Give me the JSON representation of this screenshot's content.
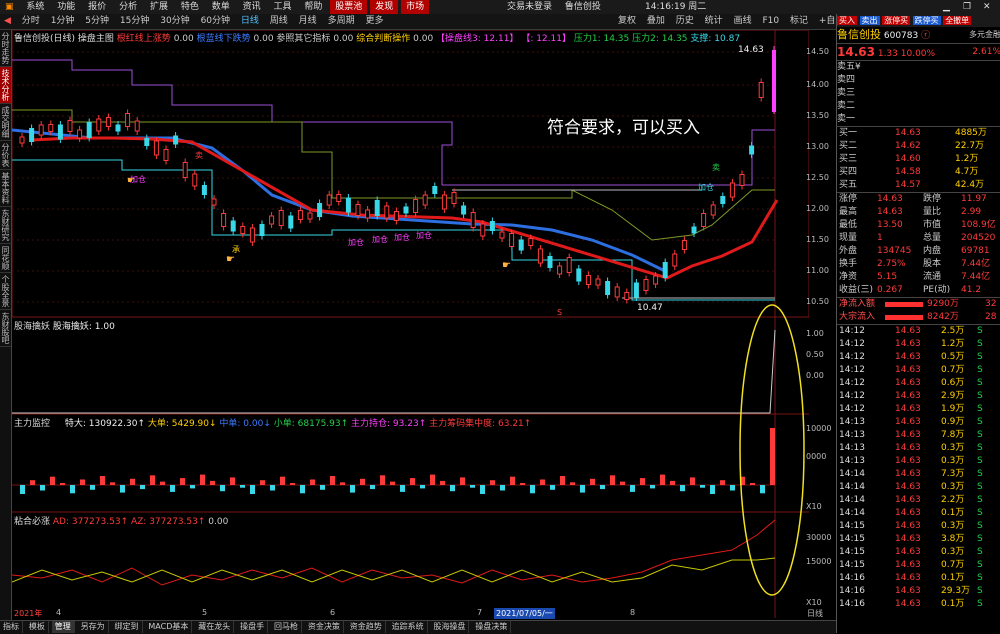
{
  "menubar": {
    "items": [
      "系统",
      "功能",
      "报价",
      "分析",
      "扩展",
      "特色",
      "数单",
      "资讯",
      "工具",
      "帮助"
    ],
    "hl_items": [
      "股票池",
      "发现",
      "市场"
    ],
    "center": [
      "交易未登录",
      "鲁信创投"
    ],
    "time": "14:16:19 周二"
  },
  "toolbar": {
    "periods": [
      "分时",
      "1分钟",
      "5分钟",
      "15分钟",
      "30分钟",
      "60分钟",
      "日线",
      "周线",
      "月线",
      "多周期",
      "更多"
    ],
    "active_period": "日线",
    "right_buttons": [
      "复权",
      "叠加",
      "历史",
      "统计",
      "画线",
      "F10",
      "标记",
      "+自选",
      "返回"
    ]
  },
  "left_tabs": [
    "分时走势",
    "技术分析",
    "成交明细",
    "分价表",
    "基本资料",
    "东财研究",
    "同花顺",
    "个股全景",
    "东财股吧"
  ],
  "left_tab_active": "技术分析",
  "main_header": {
    "name": "鲁信创投(日线)",
    "panel": "操盘主图",
    "items": [
      {
        "text": "根红线上涨势",
        "color": "#ff3a3a"
      },
      {
        "text": "0.00",
        "color": "#cccccc"
      },
      {
        "text": "根蓝线下跌势",
        "color": "#3a7cff"
      },
      {
        "text": "0.00",
        "color": "#cccccc"
      },
      {
        "text": "参照其它指标",
        "color": "#cccccc"
      },
      {
        "text": "0.00",
        "color": "#cccccc"
      },
      {
        "text": "综合判断操作",
        "color": "#ffd000"
      },
      {
        "text": "0.00",
        "color": "#cccccc"
      },
      {
        "text": "【操盘线3: 12.11】",
        "color": "#ff40ff"
      },
      {
        "text": "【: 12.11】",
        "color": "#ff40ff"
      },
      {
        "text": "压力1: 14.35",
        "color": "#22d04a"
      },
      {
        "text": "压力2: 14.35",
        "color": "#22d04a"
      },
      {
        "text": "支撑: 10.87",
        "color": "#38d8e8"
      }
    ]
  },
  "price_axis": [
    "14.50",
    "14.00",
    "13.50",
    "13.00",
    "12.50",
    "12.00",
    "11.50",
    "11.00",
    "10.50"
  ],
  "annotations": {
    "headline": "符合要求，可以买入",
    "high_mark": "14.63",
    "low_mark": "10.47",
    "jiacang": "加仓",
    "mai": "卖",
    "jiacang_list": [
      "加仓",
      "加仓",
      "加仓",
      "加仓",
      "加仓"
    ],
    "sell": "卖",
    "cheng": "承",
    "dijia": "低吸",
    "ji": "▲",
    "s_mark": "S"
  },
  "pane2": {
    "name": "股海擒妖",
    "label": "股海擒妖: 1.00",
    "axis": [
      "1.00",
      "0.50",
      "0.00"
    ],
    "top_mark": "财"
  },
  "pane3": {
    "name": "主力监控",
    "items": [
      {
        "text": "特大: 130922.30↑",
        "color": "#eeeeee"
      },
      {
        "text": "大单: 5429.90↓",
        "color": "#ffd000"
      },
      {
        "text": "中单: 0.00↓",
        "color": "#3a7cff"
      },
      {
        "text": "小单: 68175.93↑",
        "color": "#22d04a"
      },
      {
        "text": "主力持仓: 93.23↑",
        "color": "#ff40ff"
      },
      {
        "text": "主力筹码集中度: 63.21↑",
        "color": "#ff3a3a"
      }
    ],
    "axis": [
      "10000",
      "0000",
      "0"
    ],
    "bottom_label": "X10"
  },
  "pane4": {
    "name": "粘合必涨",
    "items": [
      {
        "text": "AD: 377273.53↑",
        "color": "#ff3a3a"
      },
      {
        "text": "AZ: 377273.53↑",
        "color": "#ff3a3a"
      },
      {
        "text": "0.00",
        "color": "#cccccc"
      }
    ],
    "axis": [
      "30000",
      "15000"
    ],
    "bottom_label": "X10"
  },
  "date_axis": {
    "labels": [
      "2021年",
      "4",
      "5",
      "6",
      "7",
      "2021/07/05/一",
      "8"
    ],
    "period": "日线"
  },
  "bottom_tabs": [
    "指标",
    "模板",
    "管理",
    "另存为",
    "绑定到",
    "MACD基本",
    "藏在龙头",
    "操盘手",
    "回马枪",
    "资金决策",
    "资金趋势",
    "追踪系统",
    "股海操盘",
    "操盘决策"
  ],
  "bottom_tab_active": "管理",
  "right_panel": {
    "stock_name": "鲁信创投",
    "code": "600783",
    "extra": "多元金融",
    "price": "14.63",
    "change": "1.33",
    "pct": "10.00%",
    "pct2": "2.61%",
    "asks": [
      {
        "label": "卖五",
        "price": "¥",
        "vol": ""
      },
      {
        "label": "卖四",
        "price": "",
        "vol": ""
      },
      {
        "label": "卖三",
        "price": "",
        "vol": ""
      },
      {
        "label": "卖二",
        "price": "",
        "vol": ""
      },
      {
        "label": "卖一",
        "price": "",
        "vol": ""
      }
    ],
    "bids": [
      {
        "label": "买一",
        "price": "14.63",
        "vol": "4885万"
      },
      {
        "label": "买二",
        "price": "14.62",
        "vol": "22.7万"
      },
      {
        "label": "买三",
        "price": "14.60",
        "vol": "1.2万"
      },
      {
        "label": "买四",
        "price": "14.58",
        "vol": "4.7万"
      },
      {
        "label": "买五",
        "price": "14.57",
        "vol": "42.4万"
      }
    ],
    "stats": [
      {
        "l1": "涨停",
        "v1": "14.63",
        "l2": "跌停",
        "v2": "11.97"
      },
      {
        "l1": "最高",
        "v1": "14.63",
        "l2": "量比",
        "v2": "2.99"
      },
      {
        "l1": "最低",
        "v1": "13.50",
        "l2": "市值",
        "v2": "108.9亿"
      },
      {
        "l1": "现量",
        "v1": "1",
        "l2": "总量",
        "v2": "204520"
      },
      {
        "l1": "外盘",
        "v1": "134745",
        "l2": "内盘",
        "v2": "69781"
      },
      {
        "l1": "换手",
        "v1": "2.75%",
        "l2": "股本",
        "v2": "7.44亿"
      },
      {
        "l1": "净资",
        "v1": "5.15",
        "l2": "流通",
        "v2": "7.44亿"
      },
      {
        "l1": "收益(三)",
        "v1": "0.267",
        "l2": "PE(动)",
        "v2": "41.2"
      }
    ],
    "netflow": [
      {
        "label": "净流入额",
        "value": "9290万",
        "pct": "32"
      },
      {
        "label": "大宗流入",
        "value": "8242万",
        "pct": "28"
      }
    ],
    "ticks": [
      [
        "14:12",
        "14.63",
        "2.5万",
        "S"
      ],
      [
        "14:12",
        "14.63",
        "1.2万",
        "S"
      ],
      [
        "14:12",
        "14.63",
        "0.5万",
        "S"
      ],
      [
        "14:12",
        "14.63",
        "0.7万",
        "S"
      ],
      [
        "14:12",
        "14.63",
        "0.6万",
        "S"
      ],
      [
        "14:12",
        "14.63",
        "2.9万",
        "S"
      ],
      [
        "14:12",
        "14.63",
        "1.9万",
        "S"
      ],
      [
        "14:13",
        "14.63",
        "0.9万",
        "S"
      ],
      [
        "14:13",
        "14.63",
        "7.8万",
        "S"
      ],
      [
        "14:13",
        "14.63",
        "0.3万",
        "S"
      ],
      [
        "14:13",
        "14.63",
        "0.3万",
        "S"
      ],
      [
        "14:14",
        "14.63",
        "7.3万",
        "S"
      ],
      [
        "14:14",
        "14.63",
        "0.3万",
        "S"
      ],
      [
        "14:14",
        "14.63",
        "2.2万",
        "S"
      ],
      [
        "14:14",
        "14.63",
        "0.1万",
        "S"
      ],
      [
        "14:15",
        "14.63",
        "0.3万",
        "S"
      ],
      [
        "14:15",
        "14.63",
        "3.8万",
        "S"
      ],
      [
        "14:15",
        "14.63",
        "0.3万",
        "S"
      ],
      [
        "14:15",
        "14.63",
        "0.7万",
        "S"
      ],
      [
        "14:16",
        "14.63",
        "0.1万",
        "S"
      ],
      [
        "14:16",
        "14.63",
        "29.3万",
        "S"
      ],
      [
        "14:16",
        "14.63",
        "0.1万",
        "S"
      ]
    ],
    "top_buttons": [
      "买入",
      "卖出",
      "涨停买",
      "跌停买",
      "全撤单",
      "资",
      "网",
      "站"
    ],
    "bottom_tabs": [
      "五",
      "日",
      "笔",
      "价",
      "细",
      "势",
      "联",
      "值",
      "主",
      "筹"
    ],
    "panel_period": "日线"
  }
}
